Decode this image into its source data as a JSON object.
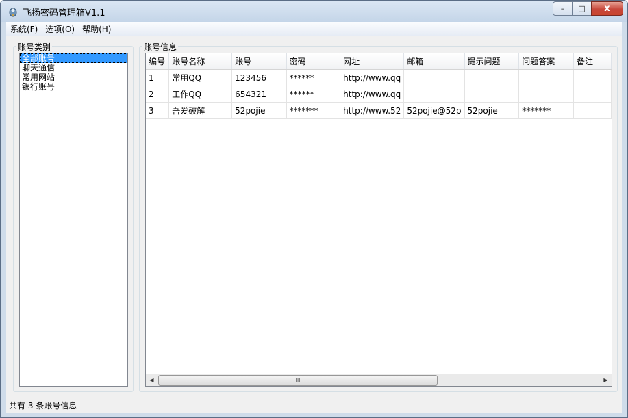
{
  "window": {
    "title": "飞扬密码管理箱V1.1"
  },
  "window_buttons": {
    "minimize": "–",
    "maximize": "□",
    "close": "x"
  },
  "menu": [
    "系统(F)",
    "选项(O)",
    "帮助(H)"
  ],
  "categories": {
    "label": "账号类别",
    "items": [
      "全部账号",
      "聊天通信",
      "常用网站",
      "银行账号"
    ],
    "selected": "全部账号"
  },
  "accounts": {
    "label": "账号信息",
    "columns": [
      "编号",
      "账号名称",
      "账号",
      "密码",
      "网址",
      "邮箱",
      "提示问题",
      "问题答案",
      "备注"
    ],
    "rows": [
      [
        "1",
        "常用QQ",
        "123456",
        "******",
        "http://www.qq",
        "",
        "",
        "",
        ""
      ],
      [
        "2",
        "工作QQ",
        "654321",
        "******",
        "http://www.qq",
        "",
        "",
        "",
        ""
      ],
      [
        "3",
        "吾爱破解",
        "52pojie",
        "*******",
        "http://www.52",
        "52pojie@52p",
        "52pojie",
        "*******",
        ""
      ]
    ]
  },
  "scrollbar": {
    "left_arrow": "◀",
    "right_arrow": "▶",
    "grip": "III"
  },
  "status": {
    "text": "共有 3 条账号信息"
  }
}
